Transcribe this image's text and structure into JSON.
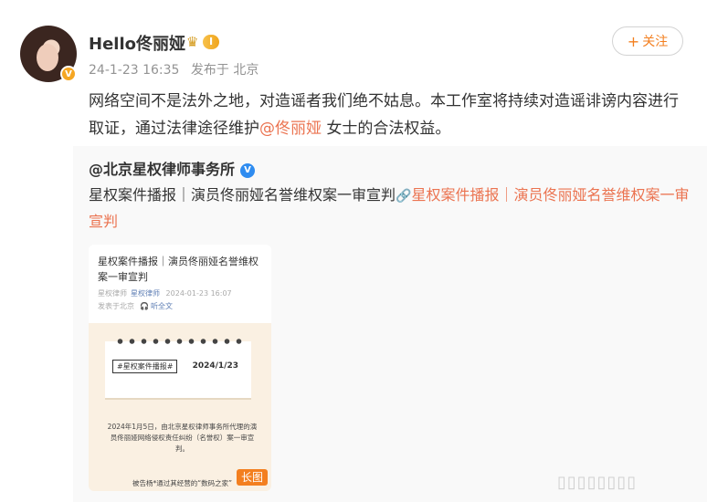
{
  "post": {
    "username": "Hello佟丽娅",
    "level_badge": "I",
    "time": "24-1-23 16:35",
    "source": "发布于 北京",
    "follow_label": "关注",
    "text_before": "网络空间不是法外之地，对造谣者我们绝不姑息。本工作室将持续对造谣诽谤内容进行取证，通过法律途径维护",
    "mention": "@佟丽娅",
    "text_after": " 女士的合法权益。"
  },
  "repost": {
    "author": "@北京星权律师事务所",
    "text": "星权案件播报｜演员佟丽娅名誉维权案一审宣判",
    "link_text": "星权案件播报｜演员佟丽娅名誉维权案一审宣判",
    "card": {
      "title": "星权案件播报｜演员佟丽娅名誉维权案一审宣判",
      "meta_author": "星权律师",
      "meta_account": "星权律师",
      "meta_time": "2024-01-23 16:07",
      "meta_location": "发表于北京",
      "meta_listen": "听全文",
      "tag": "#星权案件播报#",
      "date": "2024/1/23",
      "body": "2024年1月5日，由北京星权律师事务所代理的演员佟丽娅网络侵权责任纠纷（名誉权）案一审宣判。",
      "foot": "被告杨*通过其经营的“数码之家”",
      "long_badge": "长图"
    }
  },
  "icons": {
    "verified": "verified-v-icon",
    "crown": "crown-icon",
    "link": "link-icon"
  },
  "colors": {
    "accent": "#eb7350",
    "follow": "#f37f1f"
  }
}
